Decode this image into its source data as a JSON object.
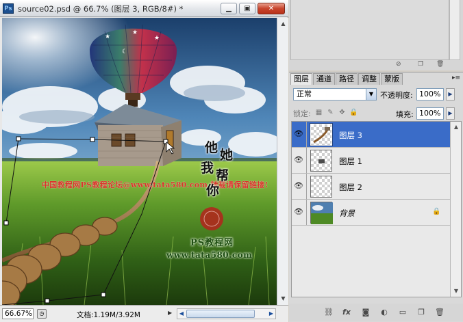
{
  "app": {
    "icon_label": "Ps"
  },
  "document": {
    "title": "source02.psd @ 66.7% (图层 3, RGB/8#) *",
    "zoom": "66.67%",
    "doc_size": "文档:1.19M/3.92M"
  },
  "window_buttons": {
    "minimize": "▁",
    "maximize": "▣",
    "close": "✕"
  },
  "canvas_text": {
    "red_watermark": "中国教程网PS教程论坛@www.tata580.com  转载请保留链接!",
    "brush_chars": [
      "他",
      "她",
      "我",
      "帮",
      "你"
    ],
    "site_line1": "PS教程网",
    "site_line2": "www.tata580.com"
  },
  "layers_panel": {
    "tabs": [
      "图层",
      "通道",
      "路径",
      "调整",
      "蒙版"
    ],
    "active_tab": 0,
    "blend_mode": "正常",
    "opacity_label": "不透明度:",
    "opacity": "100%",
    "lock_label": "锁定:",
    "fill_label": "填充:",
    "fill": "100%",
    "layers": [
      {
        "name": "图层 3",
        "selected": true,
        "thumbnail": "rope-with-house"
      },
      {
        "name": "图层 1",
        "selected": false,
        "thumbnail": "small-object"
      },
      {
        "name": "图层 2",
        "selected": false,
        "thumbnail": "transparent"
      },
      {
        "name": "背景",
        "selected": false,
        "thumbnail": "landscape",
        "locked": true
      }
    ],
    "footer_icons": [
      "link-icon",
      "fx-icon",
      "mask-icon",
      "adjustment-icon",
      "group-folder-icon",
      "new-layer-icon",
      "delete-icon"
    ]
  },
  "colors": {
    "selected_layer": "#3a6cc8",
    "close_button": "#c8452d",
    "watermark_red": "#d8362a",
    "watermark_green": "#1f4e12"
  }
}
